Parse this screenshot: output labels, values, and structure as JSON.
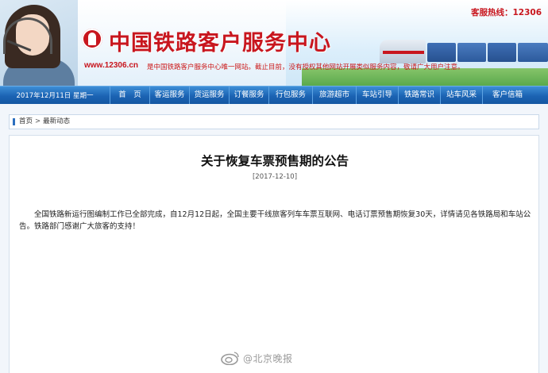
{
  "header": {
    "hotline": "客服热线：12306",
    "logo_text": "中国铁路客户服务中心",
    "site_url": "www.12306.cn",
    "site_note": "是中国铁路客户服务中心唯一网站。截止目前，没有授权其他网站开展类似服务内容，敬请广大用户注意。"
  },
  "nav": {
    "date": "2017年12月11日 星期一",
    "items": [
      "首　页",
      "客运服务",
      "货运服务",
      "订餐服务",
      "行包服务",
      "旅游超市",
      "车站引导",
      "铁路常识",
      "站车风采",
      "客户信箱"
    ]
  },
  "breadcrumb": {
    "home": "首页",
    "separator": ">",
    "current": "最新动态"
  },
  "article": {
    "title": "关于恢复车票预售期的公告",
    "date": "[2017-12-10]",
    "body": "全国铁路新运行图编制工作已全部完成，自12月12日起，全国主要干线旅客列车车票互联网、电话订票预售期恢复30天，详情请见各铁路局和车站公告。铁路部门感谢广大旅客的支持！"
  },
  "watermark": {
    "text": "@北京晚报"
  },
  "colors": {
    "brand_red": "#c8161e",
    "nav_blue": "#1b63b3"
  }
}
